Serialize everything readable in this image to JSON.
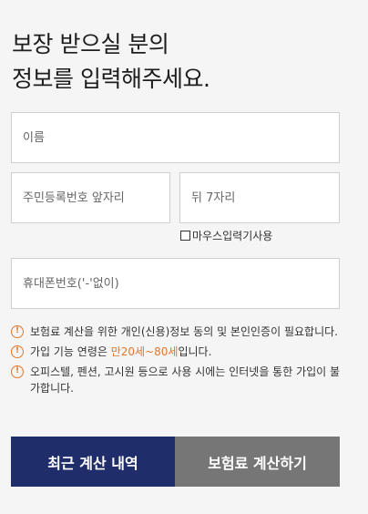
{
  "title": {
    "line1": "보장 받으실 분의",
    "line2": "정보를 입력해주세요."
  },
  "fields": {
    "name_placeholder": "이름",
    "jumin_front_placeholder": "주민등록번호 앞자리",
    "jumin_back_placeholder": "뒤 7자리",
    "phone_placeholder": "휴대폰번호('-'없이)"
  },
  "mouse_input": {
    "label": "마우스입력기사용",
    "checked": false
  },
  "notices": [
    {
      "text": "보험료 계산을 위한 개인(신용)정보 동의 및 본인인증이 필요합니다."
    },
    {
      "prefix": "가입 기능 연령은 ",
      "highlight": "만20세~80세",
      "suffix": "입니다."
    },
    {
      "text": "오피스텔, 펜션, 고시원 등으로 사용 시에는 인터넷을 통한 가입이 불가합니다."
    }
  ],
  "icons": {
    "notice": "exclamation-circle-icon"
  },
  "colors": {
    "primary": "#1f2d6a",
    "secondary": "#767676",
    "accent": "#e0772c"
  },
  "buttons": {
    "recent": "최근 계산 내역",
    "calculate": "보험료 계산하기"
  }
}
